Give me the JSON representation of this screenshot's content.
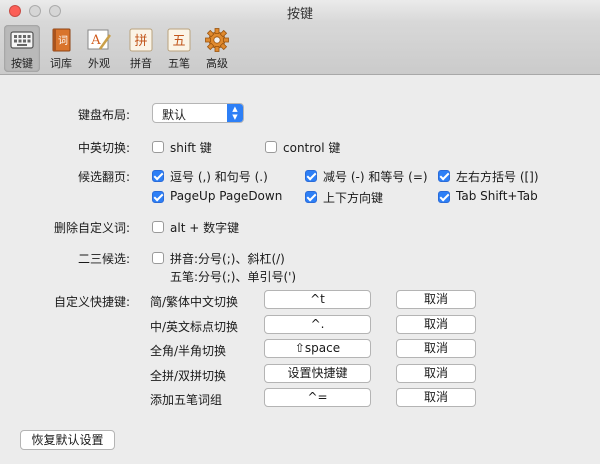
{
  "window": {
    "title": "按键"
  },
  "toolbar": {
    "items": [
      {
        "label": "按键",
        "icon": "keyboard-icon"
      },
      {
        "label": "词库",
        "icon": "dictionary-book-icon"
      },
      {
        "label": "外观",
        "icon": "appearance-icon"
      },
      {
        "label": "拼音",
        "icon": "pinyin-icon",
        "glyph": "拼"
      },
      {
        "label": "五笔",
        "icon": "wubi-icon",
        "glyph": "五"
      },
      {
        "label": "高级",
        "icon": "gear-icon"
      }
    ],
    "dict_glyph": "词",
    "appearance_glyph": "A"
  },
  "layout": {
    "label": "键盘布局:",
    "value": "默认"
  },
  "switch": {
    "label": "中英切换:",
    "shift": "shift 键",
    "control": "control 键"
  },
  "paging": {
    "label": "候选翻页:",
    "options": [
      "逗号 (,) 和句号 (.)",
      "减号 (-) 和等号 (=)",
      "左右方括号 ([])",
      "PageUp PageDown",
      "上下方向键",
      "Tab Shift+Tab"
    ]
  },
  "delete_custom": {
    "label": "删除自定义词:",
    "option": "alt + 数字键"
  },
  "second_third": {
    "label": "二三候选:",
    "line1": "拼音:分号(;)、斜杠(/)",
    "line2": "五笔:分号(;)、单引号(')"
  },
  "hotkeys": {
    "label": "自定义快捷键:",
    "rows": [
      {
        "name": "简/繁体中文切换",
        "key": "^t",
        "cancel": "取消"
      },
      {
        "name": "中/英文标点切换",
        "key": "^.",
        "cancel": "取消"
      },
      {
        "name": "全角/半角切换",
        "key": "⇧space",
        "cancel": "取消"
      },
      {
        "name": "全拼/双拼切换",
        "key": "设置快捷键",
        "cancel": "取消"
      },
      {
        "name": "添加五笔词组",
        "key": "^=",
        "cancel": "取消"
      }
    ]
  },
  "restore_label": "恢复默认设置",
  "colors": {
    "accent": "#2d7ff6",
    "close": "#fc5f57"
  }
}
